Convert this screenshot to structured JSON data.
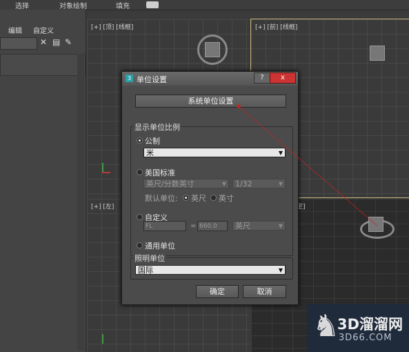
{
  "topbar": {
    "items": [
      "选择",
      "对象绘制",
      "填充"
    ],
    "toggle_icon": "display-toggle"
  },
  "command_panel": {
    "tabs": [
      "编辑",
      "自定义"
    ]
  },
  "viewports": {
    "top": "[+] [顶] [线框]",
    "front": "[+] [前] [线框]",
    "left": "[+] [左]",
    "persp_partial": "定]"
  },
  "dialog": {
    "title": "单位设置",
    "help": "?",
    "close": "x",
    "system_units_button": "系统单位设置",
    "display_group": "显示单位比例",
    "metric": {
      "label": "公制",
      "value": "米"
    },
    "us_standard": {
      "label": "美国标准",
      "value": "英尺/分数英寸",
      "fraction": "1/32",
      "default_label": "默认单位:",
      "feet": "英尺",
      "inches": "英寸"
    },
    "custom": {
      "label": "自定义",
      "field1": "FL",
      "equals": "=",
      "field2": "660.0",
      "unit": "英尺"
    },
    "generic": {
      "label": "通用单位"
    },
    "lighting_group": "照明单位",
    "lighting_value": "国际",
    "ok": "确定",
    "cancel": "取消"
  },
  "watermark": {
    "line1": "3D溜溜网",
    "line2": "3D66.COM",
    "logo": "deer-logo"
  },
  "colors": {
    "annotation_line": "#d02020",
    "titlebar_close": "#cc3333",
    "accent": "#2aa0a8"
  }
}
